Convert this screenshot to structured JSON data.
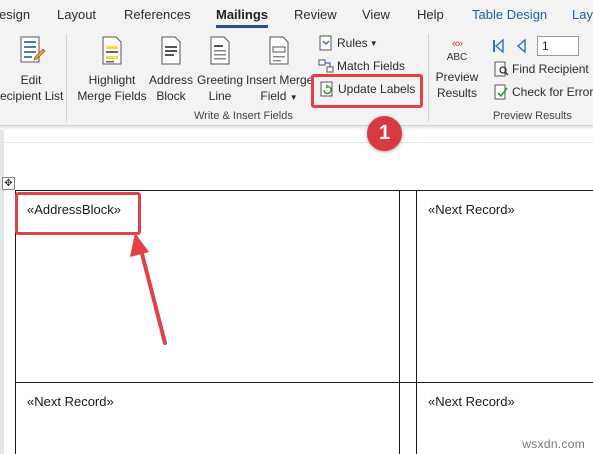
{
  "tabs": {
    "design": "esign",
    "layout": "Layout",
    "references": "References",
    "mailings": "Mailings",
    "review": "Review",
    "view": "View",
    "help": "Help",
    "table_design": "Table Design",
    "layout2": "Lay"
  },
  "ribbon": {
    "edit_recipient_line1": "Edit",
    "edit_recipient_line2": "ecipient List",
    "highlight_line1": "Highlight",
    "highlight_line2": "Merge Fields",
    "address_line1": "Address",
    "address_line2": "Block",
    "greeting_line1": "Greeting",
    "greeting_line2": "Line",
    "insert_line1": "Insert Merge",
    "insert_line2": "Field",
    "rules": "Rules",
    "match_fields": "Match Fields",
    "update_labels": "Update Labels",
    "group_write_insert": "Write & Insert Fields",
    "preview_abc": "ABC",
    "preview_line1": "Preview",
    "preview_line2": "Results",
    "record_number": "1",
    "find_recipient": "Find Recipient",
    "check_errors": "Check for Errors",
    "group_preview": "Preview Results"
  },
  "callout": {
    "step_number": "1"
  },
  "document": {
    "cells": {
      "r1c1": "«AddressBlock»",
      "r1c3": "«Next Record»",
      "r2c1": "«Next Record»",
      "r2c3": "«Next Record»"
    }
  },
  "watermark": "wsxdn.com",
  "colors": {
    "highlight": "#e1424a",
    "badge": "#d83a43",
    "accent": "#2e4f8a",
    "contextual_tab": "#1f5fa8"
  }
}
